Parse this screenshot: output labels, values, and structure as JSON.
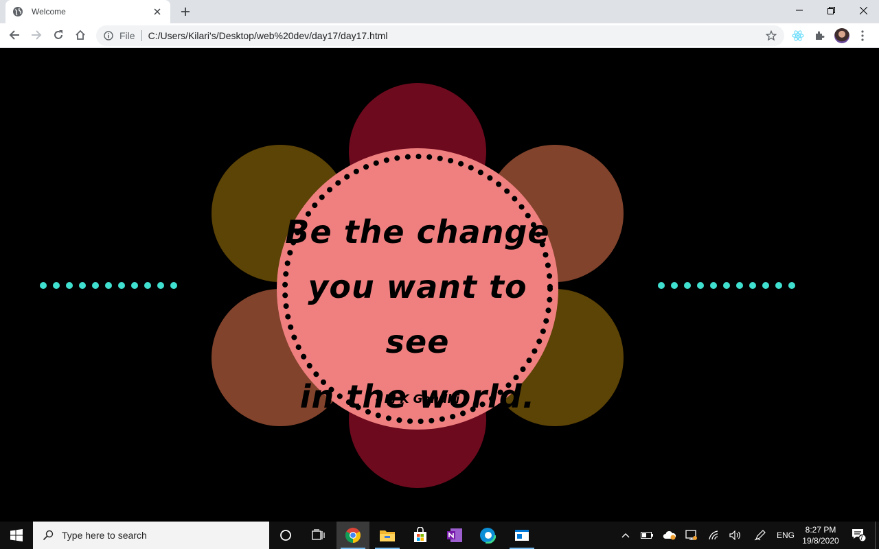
{
  "browser": {
    "tab_title": "Welcome",
    "omnibox_scheme": "File",
    "url": "C:/Users/Kilari's/Desktop/web%20dev/day17/day17.html"
  },
  "page": {
    "quote_lines": [
      "Be the change",
      "you want to see",
      "in the world."
    ],
    "author": "- M K Gandhi",
    "colors": {
      "background": "#000000",
      "center": "#f08080",
      "petal_top_bottom": "#6e0a1e",
      "petal_olive": "#5c4306",
      "petal_brown": "#82432c",
      "dots": "#40e0d0"
    },
    "dot_count_left": 11,
    "dot_count_right": 11
  },
  "taskbar": {
    "search_placeholder": "Type here to search",
    "language": "ENG",
    "time": "8:27 PM",
    "date": "19/8/2020",
    "notification_count": "7"
  }
}
